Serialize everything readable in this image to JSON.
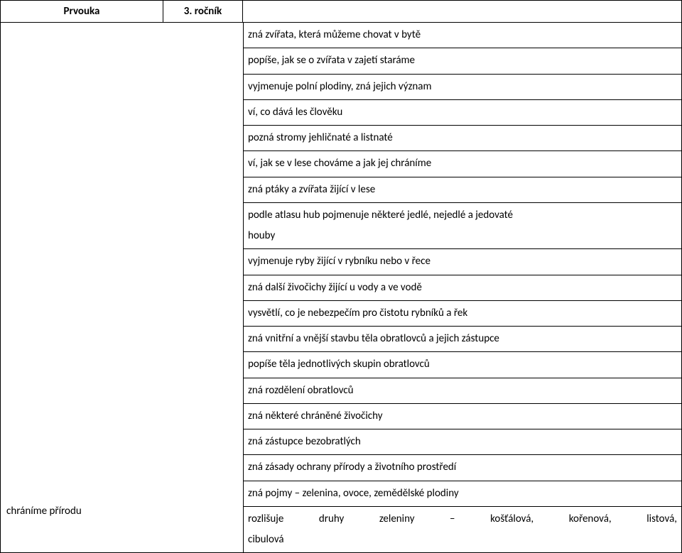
{
  "header": {
    "col1": "Prvouka",
    "col2": "3. ročník",
    "col3": ""
  },
  "left_column_label": "chráníme přírodu",
  "rows": [
    {
      "text": "zná zvířata, která můžeme chovat v bytě"
    },
    {
      "text": "popíše, jak se o zvířata v zajetí staráme"
    },
    {
      "text": "vyjmenuje polní plodiny, zná jejich význam"
    },
    {
      "text": "ví, co dává les člověku"
    },
    {
      "text": "pozná stromy jehličnaté a listnaté"
    },
    {
      "text": "ví, jak se v lese chováme a jak jej chráníme"
    },
    {
      "text": "zná ptáky a zvířata žijící v lese"
    },
    {
      "text": "podle atlasu hub pojmenuje některé jedlé, nejedlé a jedovaté",
      "text2": "houby",
      "two": true
    },
    {
      "text": "vyjmenuje ryby žijící v rybníku nebo v řece"
    },
    {
      "text": "zná další živočichy žijící u vody a ve vodě"
    },
    {
      "text": "vysvětlí, co je nebezpečím pro čistotu rybníků a řek"
    },
    {
      "text": "zná vnitřní a vnější stavbu těla obratlovců a jejich zástupce"
    },
    {
      "text": "popíše těla jednotlivých skupin obratlovců"
    },
    {
      "text": "zná rozdělení obratlovců"
    },
    {
      "text": "zná některé chráněné živočichy"
    },
    {
      "text": "zná zástupce bezobratlých"
    },
    {
      "text": "zná zásady ochrany přírody a životního prostředí"
    },
    {
      "text": "zná pojmy – zelenina, ovoce, zemědělské plodiny"
    },
    {
      "text": "rozlišuje druhy zeleniny – košťálová, kořenová, listová,",
      "text2": "cibulová",
      "two": true,
      "justify": true
    }
  ]
}
